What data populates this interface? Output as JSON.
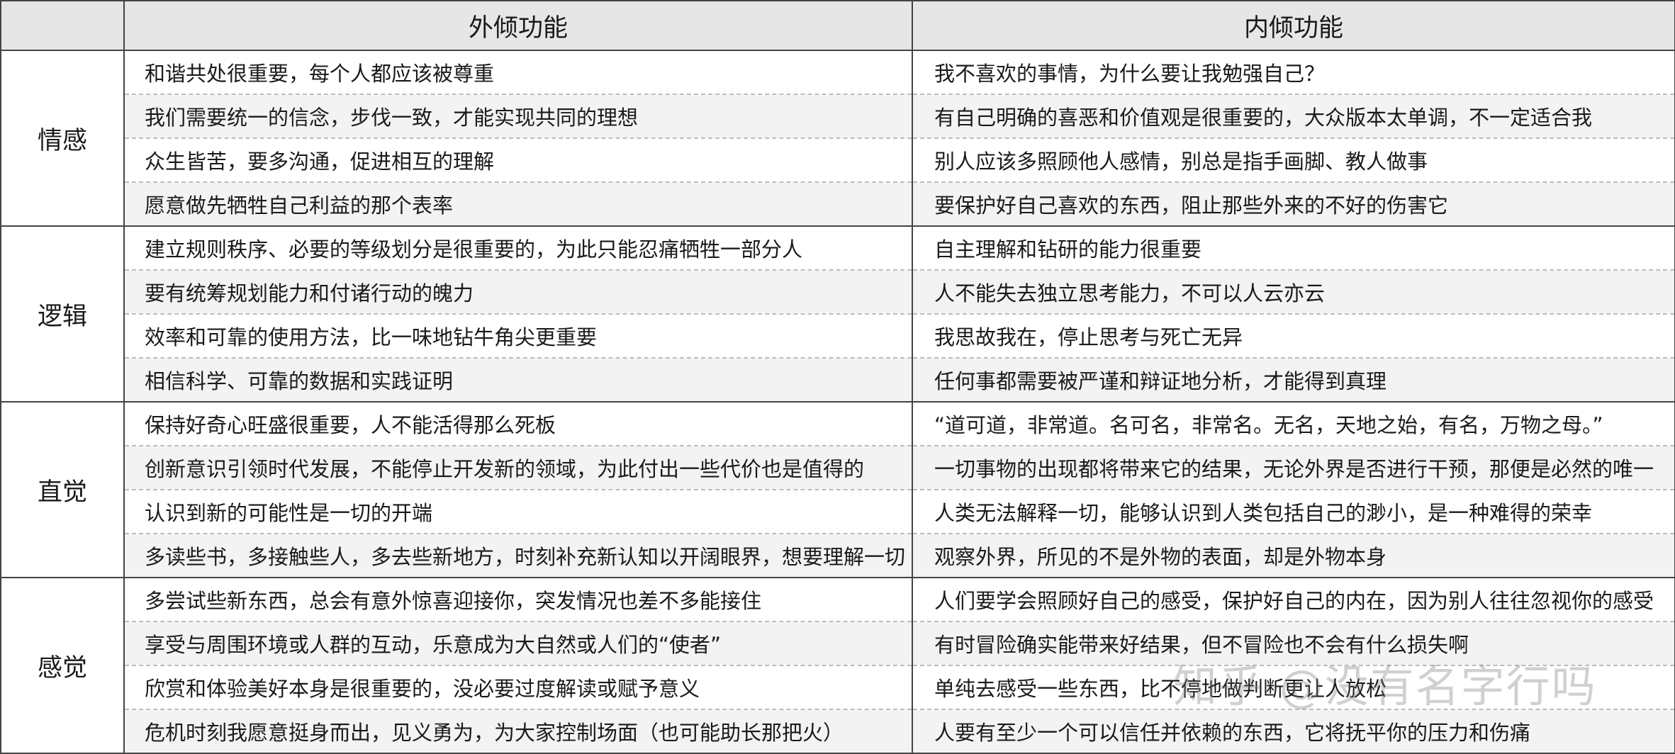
{
  "header": {
    "corner": "",
    "col_left": "外倾功能",
    "col_right": "内倾功能"
  },
  "groups": [
    {
      "name": "情感",
      "rows": [
        {
          "left": "和谐共处很重要，每个人都应该被尊重",
          "right": "我不喜欢的事情，为什么要让我勉强自己？"
        },
        {
          "left": "我们需要统一的信念，步伐一致，才能实现共同的理想",
          "right": "有自己明确的喜恶和价值观是很重要的，大众版本太单调，不一定适合我"
        },
        {
          "left": "众生皆苦，要多沟通，促进相互的理解",
          "right": "别人应该多照顾他人感情，别总是指手画脚、教人做事"
        },
        {
          "left": "愿意做先牺牲自己利益的那个表率",
          "right": "要保护好自己喜欢的东西，阻止那些外来的不好的伤害它"
        }
      ]
    },
    {
      "name": "逻辑",
      "rows": [
        {
          "left": "建立规则秩序、必要的等级划分是很重要的，为此只能忍痛牺牲一部分人",
          "right": "自主理解和钻研的能力很重要"
        },
        {
          "left": "要有统筹规划能力和付诸行动的魄力",
          "right": "人不能失去独立思考能力，不可以人云亦云"
        },
        {
          "left": "效率和可靠的使用方法，比一味地钻牛角尖更重要",
          "right": "我思故我在，停止思考与死亡无异"
        },
        {
          "left": "相信科学、可靠的数据和实践证明",
          "right": "任何事都需要被严谨和辩证地分析，才能得到真理"
        }
      ]
    },
    {
      "name": "直觉",
      "rows": [
        {
          "left": "保持好奇心旺盛很重要，人不能活得那么死板",
          "right": "“道可道，非常道。名可名，非常名。无名，天地之始，有名，万物之母。”"
        },
        {
          "left": "创新意识引领时代发展，不能停止开发新的领域，为此付出一些代价也是值得的",
          "right": "一切事物的出现都将带来它的结果，无论外界是否进行干预，那便是必然的唯一"
        },
        {
          "left": "认识到新的可能性是一切的开端",
          "right": "人类无法解释一切，能够认识到人类包括自己的渺小，是一种难得的荣幸"
        },
        {
          "left": "多读些书，多接触些人，多去些新地方，时刻补充新认知以开阔眼界，想要理解一切",
          "right": "观察外界，所见的不是外物的表面，却是外物本身"
        }
      ]
    },
    {
      "name": "感觉",
      "rows": [
        {
          "left": "多尝试些新东西，总会有意外惊喜迎接你，突发情况也差不多能接住",
          "right": "人们要学会照顾好自己的感受，保护好自己的内在，因为别人往往忽视你的感受"
        },
        {
          "left": "享受与周围环境或人群的互动，乐意成为大自然或人们的“使者”",
          "right": "有时冒险确实能带来好结果，但不冒险也不会有什么损失啊"
        },
        {
          "left": "欣赏和体验美好本身是很重要的，没必要过度解读或赋予意义",
          "right": "单纯去感受一些东西，比不停地做判断更让人放松"
        },
        {
          "left": "危机时刻我愿意挺身而出，见义勇为，为大家控制场面（也可能助长那把火）",
          "right": "人要有至少一个可以信任并依赖的东西，它将抚平你的压力和伤痛"
        }
      ]
    }
  ],
  "watermark": "知乎 @没有名字行吗"
}
